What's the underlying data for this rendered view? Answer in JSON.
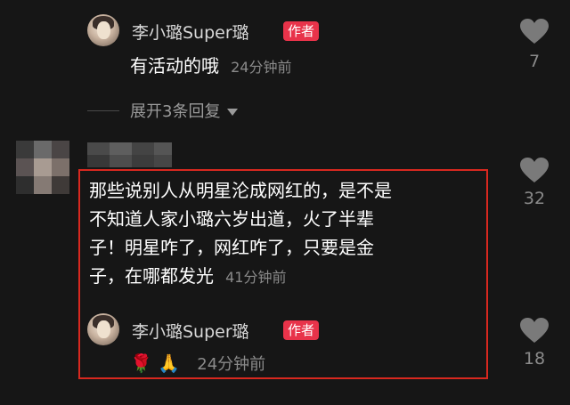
{
  "comments": [
    {
      "username": "李小璐Super璐",
      "badge": "作者",
      "text": "有活动的哦",
      "time": "24分钟前",
      "likes": "7"
    },
    {
      "text_lines": [
        "那些说别人从明星沦成网红的，是不是",
        "不知道人家小璐六岁出道，火了半辈",
        "子！明星咋了，网红咋了，只要是金",
        "子，在哪都发光"
      ],
      "time": "41分钟前",
      "likes": "32"
    },
    {
      "username": "李小璐Super璐",
      "badge": "作者",
      "emoji": "🌹 🙏",
      "time": "24分钟前",
      "likes": "18"
    }
  ],
  "expand_replies": "展开3条回复",
  "icons": {
    "like": "heart-icon",
    "expand": "caret-down-icon"
  },
  "colors": {
    "background": "#161616",
    "badge": "#e8334a",
    "highlight_box": "#d8281f"
  }
}
